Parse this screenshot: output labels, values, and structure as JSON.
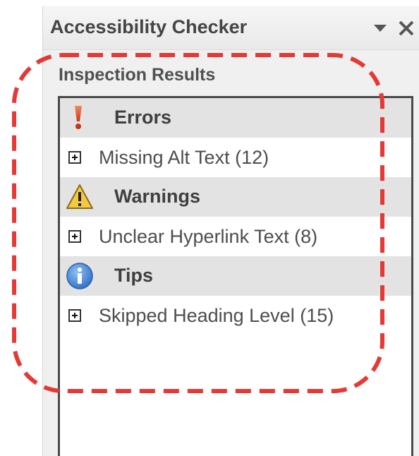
{
  "pane": {
    "title": "Accessibility Checker",
    "menu_icon": "dropdown-triangle-icon",
    "close_icon": "close-icon"
  },
  "inspection": {
    "heading": "Inspection Results",
    "categories": [
      {
        "label": "Errors",
        "icon": "error-exclamation-icon",
        "issues": [
          {
            "label": "Missing Alt Text (12)"
          }
        ]
      },
      {
        "label": "Warnings",
        "icon": "warning-triangle-icon",
        "issues": [
          {
            "label": "Unclear Hyperlink Text (8)"
          }
        ]
      },
      {
        "label": "Tips",
        "icon": "info-icon",
        "issues": [
          {
            "label": "Skipped Heading Level (15)"
          }
        ]
      }
    ]
  },
  "colors": {
    "annotation": "#e53935",
    "error": "#d9472b",
    "warning": "#f5c842",
    "info": "#3a7fd5"
  }
}
